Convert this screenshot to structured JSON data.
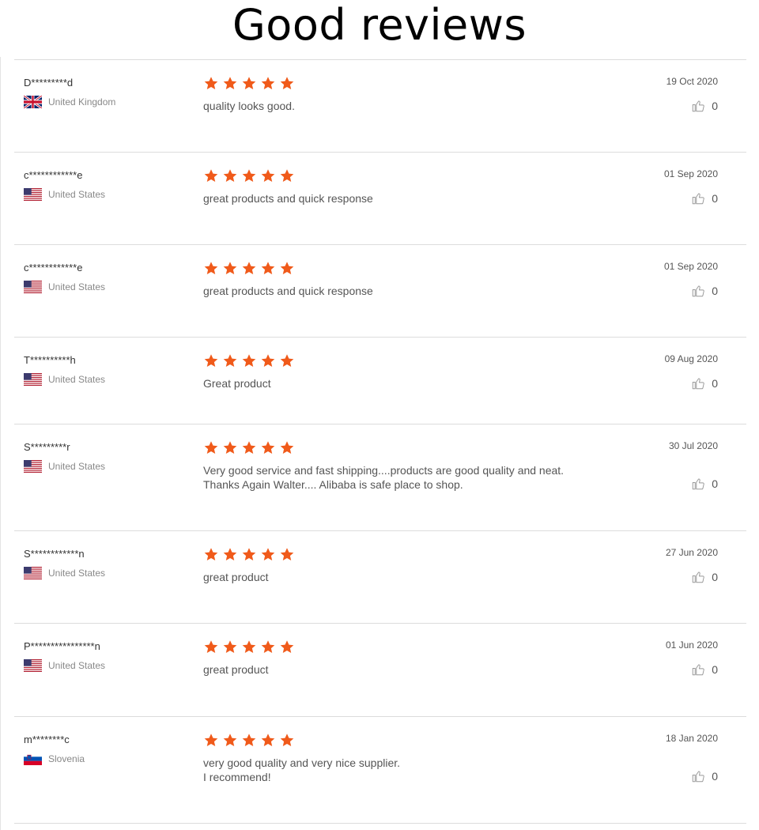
{
  "page": {
    "title": "Good reviews"
  },
  "colors": {
    "star": "#f05a1a",
    "divider": "#dcdcdc"
  },
  "reviews": [
    {
      "name": "D*********d",
      "country": "United Kingdom",
      "flag": "uk",
      "rating": 5,
      "text": "quality looks good.",
      "date": "19 Oct 2020",
      "likes": "0"
    },
    {
      "name": "c************e",
      "country": "United States",
      "flag": "us",
      "rating": 5,
      "text": "great products and quick response",
      "date": "01 Sep 2020",
      "likes": "0"
    },
    {
      "name": "c************e",
      "country": "United States",
      "flag": "us",
      "rating": 5,
      "text": "great products and quick response",
      "date": "01 Sep 2020",
      "likes": "0"
    },
    {
      "name": "T**********h",
      "country": "United States",
      "flag": "us",
      "rating": 5,
      "text": "Great product",
      "date": "09 Aug 2020",
      "likes": "0"
    },
    {
      "name": "S*********r",
      "country": "United States",
      "flag": "us",
      "rating": 5,
      "text": "Very good service and fast shipping....products are good quality and neat.\nThanks Again Walter....  Alibaba is safe place to shop.",
      "date": "30 Jul 2020",
      "likes": "0"
    },
    {
      "name": "S************n",
      "country": "United States",
      "flag": "us",
      "rating": 5,
      "text": "great product",
      "date": "27 Jun 2020",
      "likes": "0"
    },
    {
      "name": "P****************n",
      "country": "United States",
      "flag": "us",
      "rating": 5,
      "text": "great product",
      "date": "01 Jun 2020",
      "likes": "0"
    },
    {
      "name": "m********c",
      "country": "Slovenia",
      "flag": "si",
      "rating": 5,
      "text": "very good quality and very nice supplier.\nI recommend!",
      "date": "18 Jan 2020",
      "likes": "0"
    }
  ]
}
